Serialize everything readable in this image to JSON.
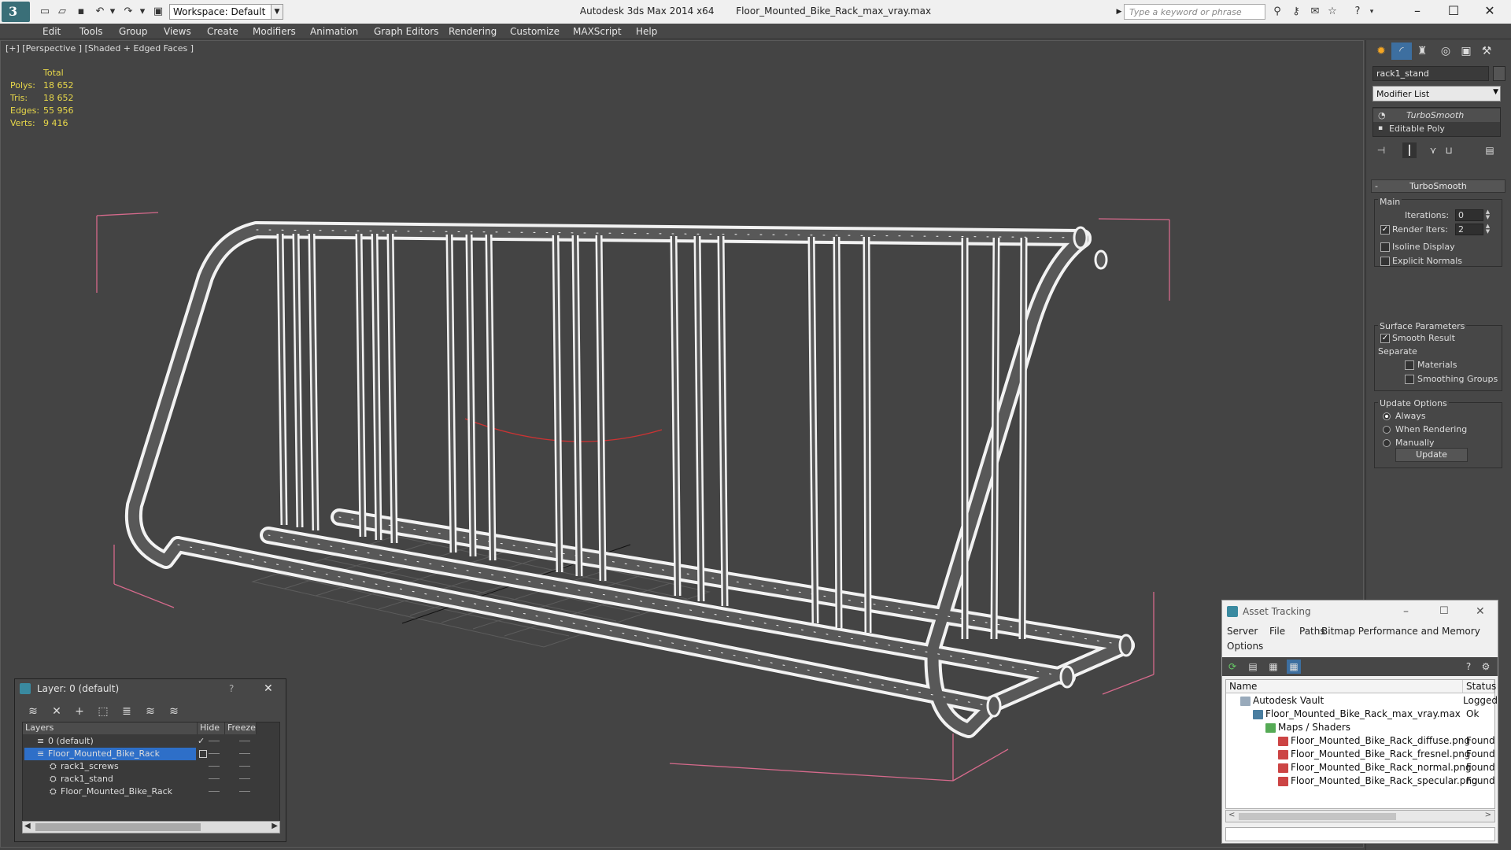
{
  "titlebar": {
    "workspace_label": "Workspace: Default",
    "app_title": "Autodesk 3ds Max  2014 x64",
    "file_title": "Floor_Mounted_Bike_Rack_max_vray.max",
    "search_placeholder": "Type a keyword or phrase"
  },
  "menu": [
    "Edit",
    "Tools",
    "Group",
    "Views",
    "Create",
    "Modifiers",
    "Animation",
    "Graph Editors",
    "Rendering",
    "Customize",
    "MAXScript",
    "Help"
  ],
  "viewport": {
    "label": "[+] [Perspective ] [Shaded + Edged Faces ]",
    "stats": {
      "header": "Total",
      "rows": [
        {
          "label": "Polys:",
          "value": "18 652"
        },
        {
          "label": "Tris:",
          "value": "18 652"
        },
        {
          "label": "Edges:",
          "value": "55 956"
        },
        {
          "label": "Verts:",
          "value": "9 416"
        }
      ]
    }
  },
  "command_panel": {
    "object_name": "rack1_stand",
    "modifier_list": "Modifier List",
    "stack": [
      "TurboSmooth",
      "Editable Poly"
    ],
    "rollout_title": "TurboSmooth",
    "main_label": "Main",
    "iterations_label": "Iterations:",
    "iterations_value": "0",
    "render_iters_label": "Render Iters:",
    "render_iters_value": "2",
    "isoline_label": "Isoline Display",
    "explicit_normals_label": "Explicit Normals",
    "surface_params_label": "Surface Parameters",
    "smooth_result_label": "Smooth Result",
    "separate_label": "Separate",
    "materials_label": "Materials",
    "smoothing_groups_label": "Smoothing Groups",
    "update_options_label": "Update Options",
    "always_label": "Always",
    "when_rendering_label": "When Rendering",
    "manually_label": "Manually",
    "update_button": "Update"
  },
  "layer_dialog": {
    "title": "Layer: 0 (default)",
    "help": "?",
    "columns": [
      "Layers",
      "Hide",
      "Freeze"
    ],
    "rows": [
      {
        "name": "0 (default)",
        "indent": 1,
        "selected": false
      },
      {
        "name": "Floor_Mounted_Bike_Rack",
        "indent": 1,
        "selected": true
      },
      {
        "name": "rack1_screws",
        "indent": 2,
        "selected": false
      },
      {
        "name": "rack1_stand",
        "indent": 2,
        "selected": false
      },
      {
        "name": "Floor_Mounted_Bike_Rack",
        "indent": 2,
        "selected": false
      }
    ]
  },
  "asset_tracking": {
    "title": "Asset Tracking",
    "menu": [
      "Server",
      "File",
      "Paths",
      "Bitmap Performance and Memory",
      "Options"
    ],
    "columns": [
      "Name",
      "Status"
    ],
    "rows": [
      {
        "name": "Autodesk Vault",
        "status": "Logged",
        "indent": 1,
        "icon": "vault"
      },
      {
        "name": "Floor_Mounted_Bike_Rack_max_vray.max",
        "status": "Ok",
        "indent": 2,
        "icon": "max"
      },
      {
        "name": "Maps / Shaders",
        "status": "",
        "indent": 3,
        "icon": "maps"
      },
      {
        "name": "Floor_Mounted_Bike_Rack_diffuse.png",
        "status": "Found",
        "indent": 4,
        "icon": "png"
      },
      {
        "name": "Floor_Mounted_Bike_Rack_fresnel.png",
        "status": "Found",
        "indent": 4,
        "icon": "png"
      },
      {
        "name": "Floor_Mounted_Bike_Rack_normal.png",
        "status": "Found",
        "indent": 4,
        "icon": "png"
      },
      {
        "name": "Floor_Mounted_Bike_Rack_specular.png",
        "status": "Found",
        "indent": 4,
        "icon": "png"
      }
    ]
  }
}
